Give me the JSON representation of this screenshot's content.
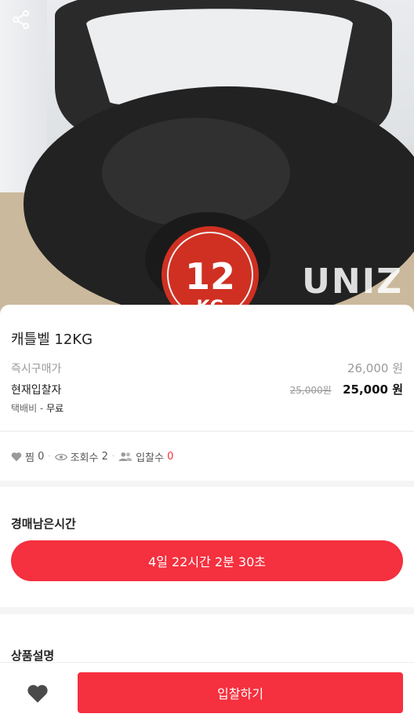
{
  "product": {
    "title": "캐틀벨 12KG",
    "image_alt": "black kettlebell 12KG",
    "watermark": "UNIZ"
  },
  "pricing": {
    "instant_buy_label": "즉시구매가",
    "instant_buy_price": "26,000 원",
    "current_bid_label": "현재입찰자",
    "previous_price": "25,000원",
    "current_price": "25,000 원",
    "shipping_label": "택배비 -",
    "shipping_value": "무료"
  },
  "stats": {
    "likes_label": "찜",
    "likes_count": "0",
    "views_label": "조회수",
    "views_count": "2",
    "bids_label": "입찰수",
    "bids_count": "0"
  },
  "auction": {
    "section_title": "경매남은시간",
    "time_remaining": "4일 22시간 2분 30초"
  },
  "description": {
    "section_title": "상품설명"
  },
  "bottom_bar": {
    "bid_button_label": "입찰하기"
  },
  "colors": {
    "accent": "#f5303f"
  },
  "icons": {
    "share": "share-icon",
    "heart": "heart-icon",
    "eye": "eye-icon",
    "users": "users-icon"
  }
}
